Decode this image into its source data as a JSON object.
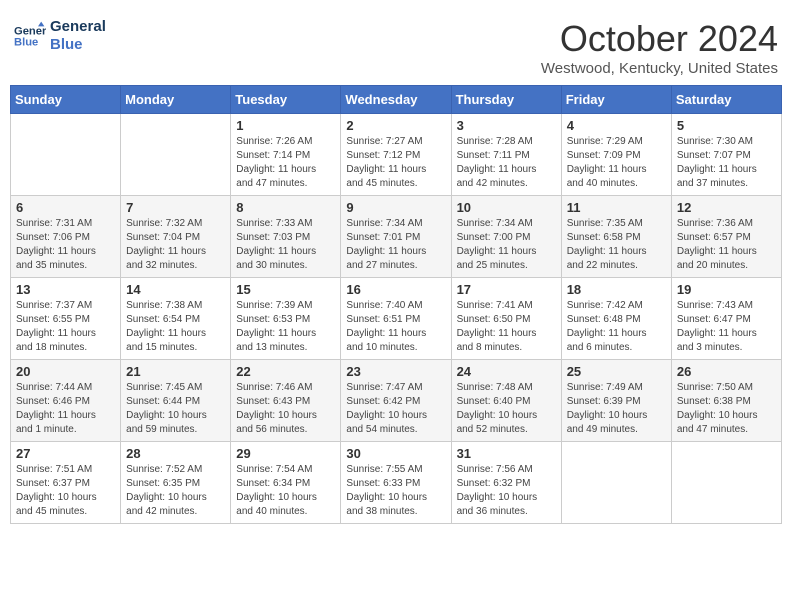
{
  "header": {
    "logo_line1": "General",
    "logo_line2": "Blue",
    "month_title": "October 2024",
    "location": "Westwood, Kentucky, United States"
  },
  "weekdays": [
    "Sunday",
    "Monday",
    "Tuesday",
    "Wednesday",
    "Thursday",
    "Friday",
    "Saturday"
  ],
  "weeks": [
    [
      {
        "day": "",
        "sunrise": "",
        "sunset": "",
        "daylight": ""
      },
      {
        "day": "",
        "sunrise": "",
        "sunset": "",
        "daylight": ""
      },
      {
        "day": "1",
        "sunrise": "Sunrise: 7:26 AM",
        "sunset": "Sunset: 7:14 PM",
        "daylight": "Daylight: 11 hours and 47 minutes."
      },
      {
        "day": "2",
        "sunrise": "Sunrise: 7:27 AM",
        "sunset": "Sunset: 7:12 PM",
        "daylight": "Daylight: 11 hours and 45 minutes."
      },
      {
        "day": "3",
        "sunrise": "Sunrise: 7:28 AM",
        "sunset": "Sunset: 7:11 PM",
        "daylight": "Daylight: 11 hours and 42 minutes."
      },
      {
        "day": "4",
        "sunrise": "Sunrise: 7:29 AM",
        "sunset": "Sunset: 7:09 PM",
        "daylight": "Daylight: 11 hours and 40 minutes."
      },
      {
        "day": "5",
        "sunrise": "Sunrise: 7:30 AM",
        "sunset": "Sunset: 7:07 PM",
        "daylight": "Daylight: 11 hours and 37 minutes."
      }
    ],
    [
      {
        "day": "6",
        "sunrise": "Sunrise: 7:31 AM",
        "sunset": "Sunset: 7:06 PM",
        "daylight": "Daylight: 11 hours and 35 minutes."
      },
      {
        "day": "7",
        "sunrise": "Sunrise: 7:32 AM",
        "sunset": "Sunset: 7:04 PM",
        "daylight": "Daylight: 11 hours and 32 minutes."
      },
      {
        "day": "8",
        "sunrise": "Sunrise: 7:33 AM",
        "sunset": "Sunset: 7:03 PM",
        "daylight": "Daylight: 11 hours and 30 minutes."
      },
      {
        "day": "9",
        "sunrise": "Sunrise: 7:34 AM",
        "sunset": "Sunset: 7:01 PM",
        "daylight": "Daylight: 11 hours and 27 minutes."
      },
      {
        "day": "10",
        "sunrise": "Sunrise: 7:34 AM",
        "sunset": "Sunset: 7:00 PM",
        "daylight": "Daylight: 11 hours and 25 minutes."
      },
      {
        "day": "11",
        "sunrise": "Sunrise: 7:35 AM",
        "sunset": "Sunset: 6:58 PM",
        "daylight": "Daylight: 11 hours and 22 minutes."
      },
      {
        "day": "12",
        "sunrise": "Sunrise: 7:36 AM",
        "sunset": "Sunset: 6:57 PM",
        "daylight": "Daylight: 11 hours and 20 minutes."
      }
    ],
    [
      {
        "day": "13",
        "sunrise": "Sunrise: 7:37 AM",
        "sunset": "Sunset: 6:55 PM",
        "daylight": "Daylight: 11 hours and 18 minutes."
      },
      {
        "day": "14",
        "sunrise": "Sunrise: 7:38 AM",
        "sunset": "Sunset: 6:54 PM",
        "daylight": "Daylight: 11 hours and 15 minutes."
      },
      {
        "day": "15",
        "sunrise": "Sunrise: 7:39 AM",
        "sunset": "Sunset: 6:53 PM",
        "daylight": "Daylight: 11 hours and 13 minutes."
      },
      {
        "day": "16",
        "sunrise": "Sunrise: 7:40 AM",
        "sunset": "Sunset: 6:51 PM",
        "daylight": "Daylight: 11 hours and 10 minutes."
      },
      {
        "day": "17",
        "sunrise": "Sunrise: 7:41 AM",
        "sunset": "Sunset: 6:50 PM",
        "daylight": "Daylight: 11 hours and 8 minutes."
      },
      {
        "day": "18",
        "sunrise": "Sunrise: 7:42 AM",
        "sunset": "Sunset: 6:48 PM",
        "daylight": "Daylight: 11 hours and 6 minutes."
      },
      {
        "day": "19",
        "sunrise": "Sunrise: 7:43 AM",
        "sunset": "Sunset: 6:47 PM",
        "daylight": "Daylight: 11 hours and 3 minutes."
      }
    ],
    [
      {
        "day": "20",
        "sunrise": "Sunrise: 7:44 AM",
        "sunset": "Sunset: 6:46 PM",
        "daylight": "Daylight: 11 hours and 1 minute."
      },
      {
        "day": "21",
        "sunrise": "Sunrise: 7:45 AM",
        "sunset": "Sunset: 6:44 PM",
        "daylight": "Daylight: 10 hours and 59 minutes."
      },
      {
        "day": "22",
        "sunrise": "Sunrise: 7:46 AM",
        "sunset": "Sunset: 6:43 PM",
        "daylight": "Daylight: 10 hours and 56 minutes."
      },
      {
        "day": "23",
        "sunrise": "Sunrise: 7:47 AM",
        "sunset": "Sunset: 6:42 PM",
        "daylight": "Daylight: 10 hours and 54 minutes."
      },
      {
        "day": "24",
        "sunrise": "Sunrise: 7:48 AM",
        "sunset": "Sunset: 6:40 PM",
        "daylight": "Daylight: 10 hours and 52 minutes."
      },
      {
        "day": "25",
        "sunrise": "Sunrise: 7:49 AM",
        "sunset": "Sunset: 6:39 PM",
        "daylight": "Daylight: 10 hours and 49 minutes."
      },
      {
        "day": "26",
        "sunrise": "Sunrise: 7:50 AM",
        "sunset": "Sunset: 6:38 PM",
        "daylight": "Daylight: 10 hours and 47 minutes."
      }
    ],
    [
      {
        "day": "27",
        "sunrise": "Sunrise: 7:51 AM",
        "sunset": "Sunset: 6:37 PM",
        "daylight": "Daylight: 10 hours and 45 minutes."
      },
      {
        "day": "28",
        "sunrise": "Sunrise: 7:52 AM",
        "sunset": "Sunset: 6:35 PM",
        "daylight": "Daylight: 10 hours and 42 minutes."
      },
      {
        "day": "29",
        "sunrise": "Sunrise: 7:54 AM",
        "sunset": "Sunset: 6:34 PM",
        "daylight": "Daylight: 10 hours and 40 minutes."
      },
      {
        "day": "30",
        "sunrise": "Sunrise: 7:55 AM",
        "sunset": "Sunset: 6:33 PM",
        "daylight": "Daylight: 10 hours and 38 minutes."
      },
      {
        "day": "31",
        "sunrise": "Sunrise: 7:56 AM",
        "sunset": "Sunset: 6:32 PM",
        "daylight": "Daylight: 10 hours and 36 minutes."
      },
      {
        "day": "",
        "sunrise": "",
        "sunset": "",
        "daylight": ""
      },
      {
        "day": "",
        "sunrise": "",
        "sunset": "",
        "daylight": ""
      }
    ]
  ]
}
